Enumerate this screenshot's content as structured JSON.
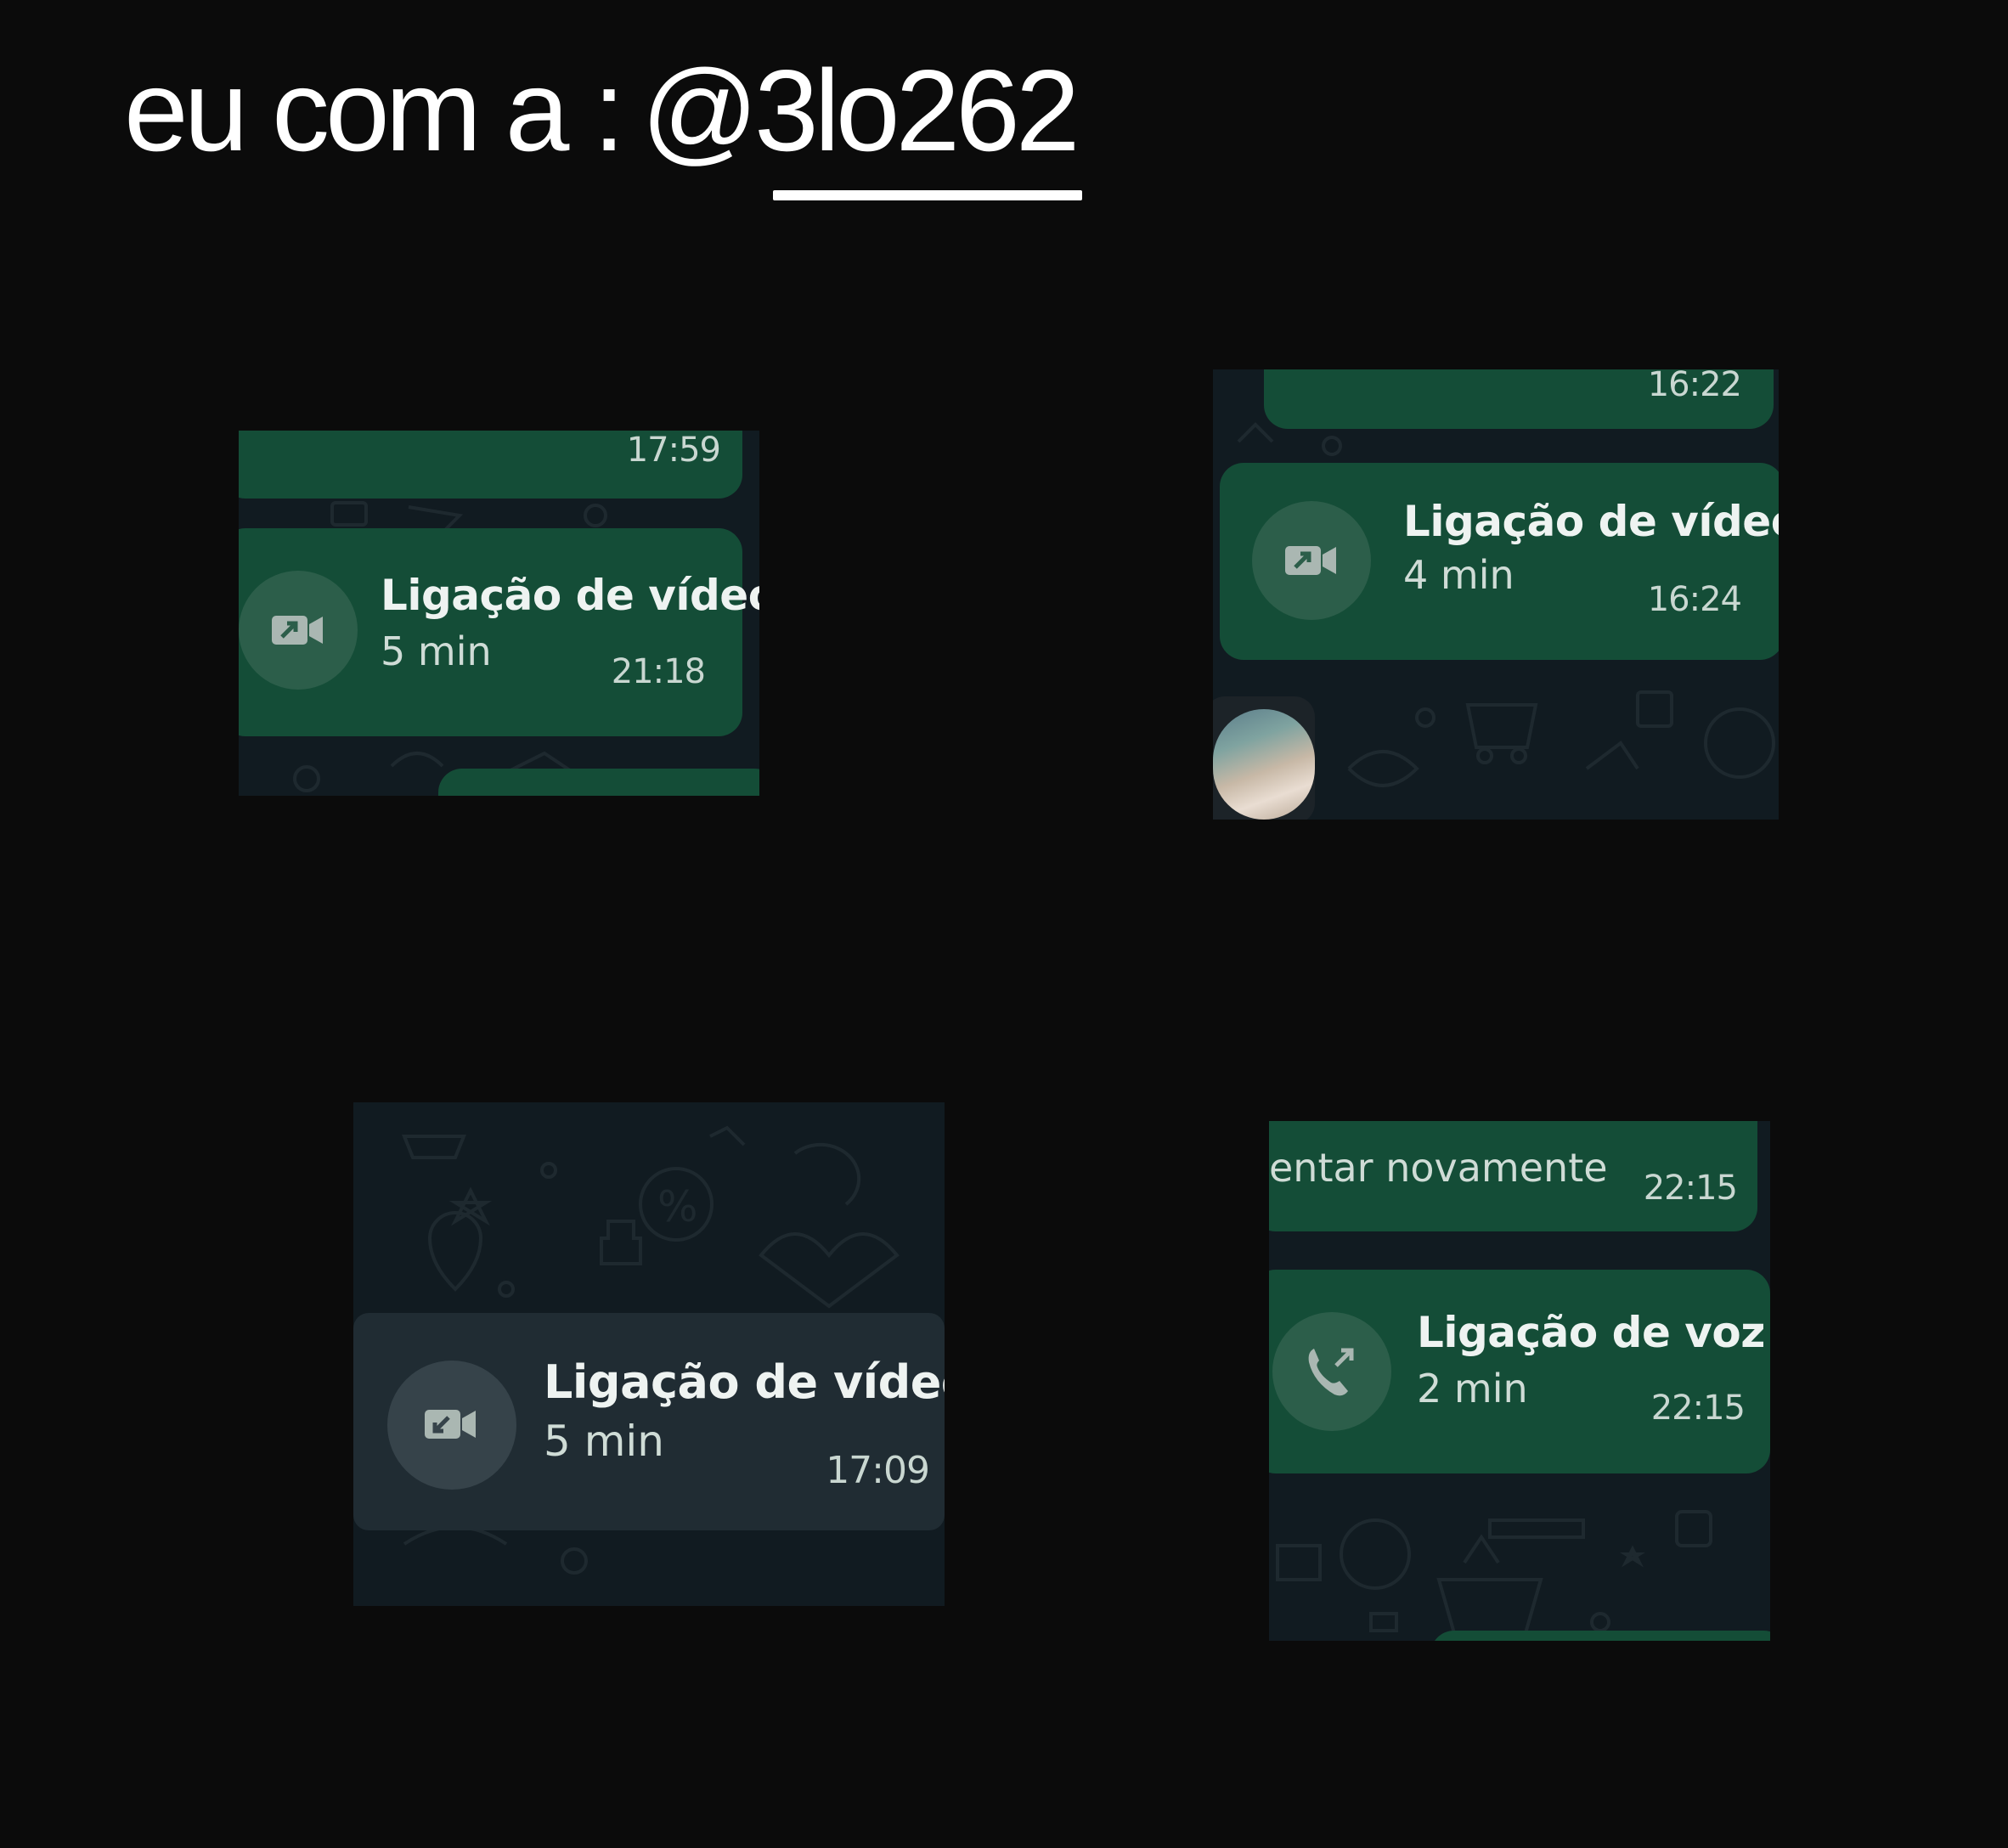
{
  "caption": {
    "prefix": "eu com a :",
    "mention": "@3lo262"
  },
  "crops": {
    "top_left": {
      "prev_bubble_time": "17:59",
      "call_title": "Ligação de vídeo",
      "call_duration": "5 min",
      "call_time": "21:18",
      "icon": "video-call-outgoing-icon"
    },
    "top_right": {
      "prev_bubble_time": "16:22",
      "call_title": "Ligação de vídeo",
      "call_duration": "4 min",
      "call_time": "16:24",
      "icon": "video-call-outgoing-icon"
    },
    "bottom_left": {
      "call_title": "Ligação de vídeo",
      "call_duration": "5 min",
      "call_time": "17:09",
      "icon": "video-call-incoming-icon"
    },
    "bottom_right": {
      "prev_bubble_text": "entar novamente",
      "prev_bubble_time": "22:15",
      "call_title": "Ligação de voz",
      "call_duration": "2 min",
      "call_time": "22:15",
      "icon": "voice-call-outgoing-icon"
    }
  },
  "colors": {
    "background": "#0b0b0b",
    "chat_wallpaper": "#111b21",
    "outgoing_bubble": "#144d37",
    "incoming_bubble": "#202c33",
    "text": "#ffffff"
  }
}
